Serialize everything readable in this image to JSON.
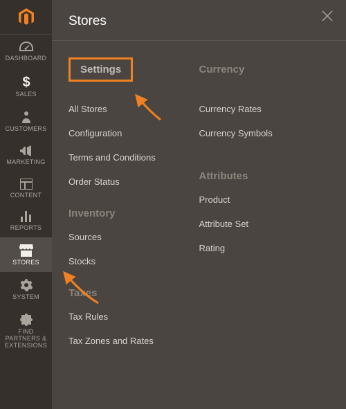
{
  "panel": {
    "title": "Stores"
  },
  "sidebar": {
    "items": [
      {
        "label": "DASHBOARD"
      },
      {
        "label": "SALES"
      },
      {
        "label": "CUSTOMERS"
      },
      {
        "label": "MARKETING"
      },
      {
        "label": "CONTENT"
      },
      {
        "label": "REPORTS"
      },
      {
        "label": "STORES"
      },
      {
        "label": "SYSTEM"
      },
      {
        "label": "FIND PARTNERS & EXTENSIONS"
      }
    ]
  },
  "columns": {
    "left": [
      {
        "heading": "Settings",
        "highlighted": true,
        "links": [
          "All Stores",
          "Configuration",
          "Terms and Conditions",
          "Order Status"
        ]
      },
      {
        "heading": "Inventory",
        "links": [
          "Sources",
          "Stocks"
        ]
      },
      {
        "heading": "Taxes",
        "links": [
          "Tax Rules",
          "Tax Zones and Rates"
        ]
      }
    ],
    "right": [
      {
        "heading": "Currency",
        "links": [
          "Currency Rates",
          "Currency Symbols"
        ]
      },
      {
        "heading": "Attributes",
        "links": [
          "Product",
          "Attribute Set",
          "Rating"
        ]
      }
    ]
  }
}
